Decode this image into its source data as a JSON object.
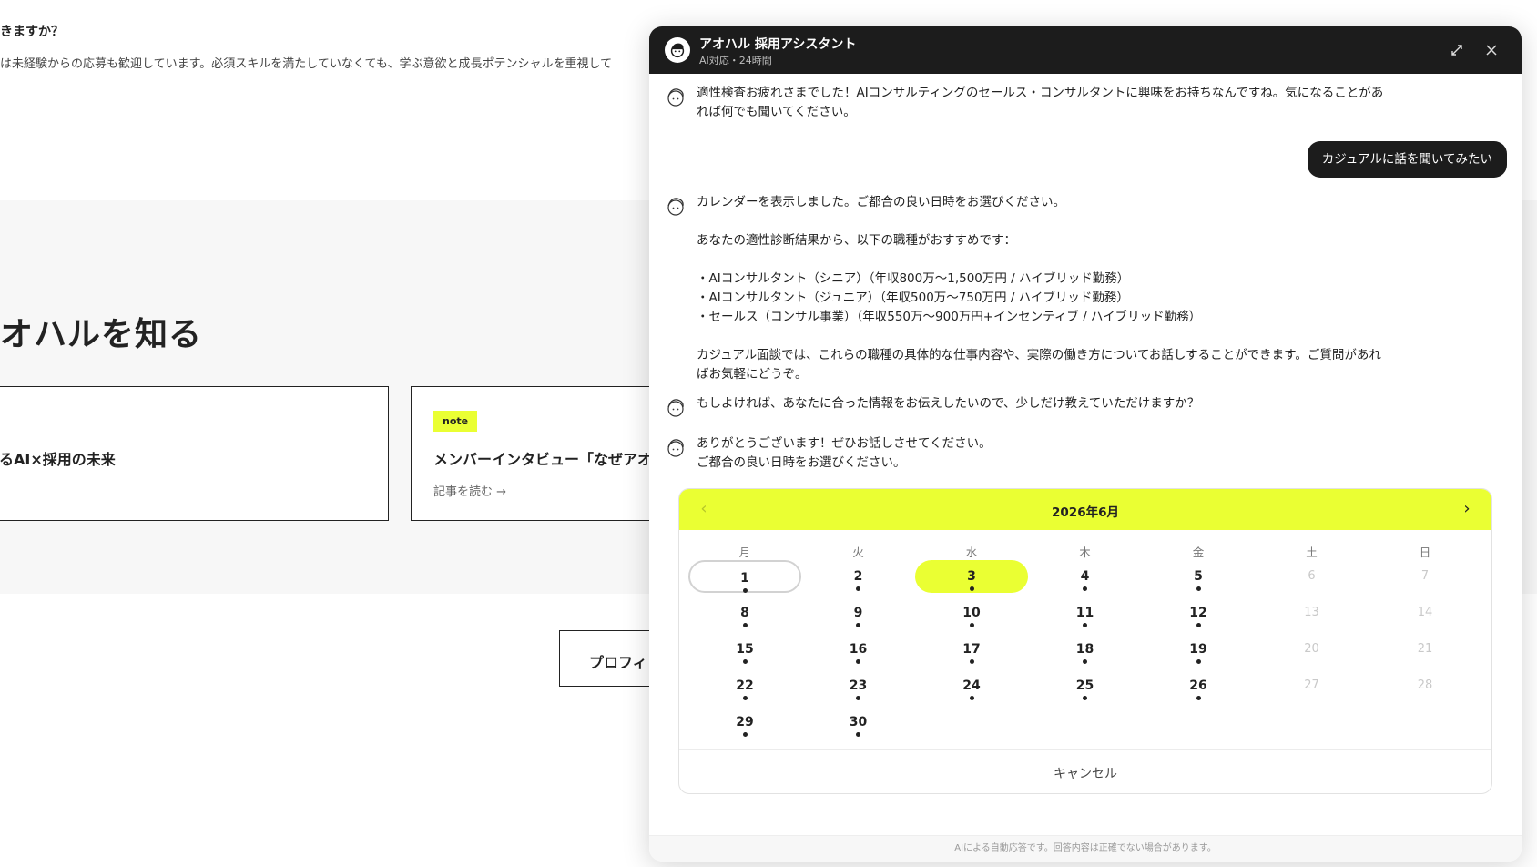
{
  "background": {
    "faq_question": "きますか？",
    "faq_answer": "は未経験からの応募も歓迎しています。必須スキルを満たしていなくても、学ぶ意欲と成長ポテンシャルを重視して",
    "section_heading": "オハルを知る",
    "cards": [
      {
        "tag": "",
        "title": "るAI×採用の未来",
        "link": ""
      },
      {
        "tag": "note",
        "title": "メンバーインタビュー「なぜアオ",
        "link": "記事を読む →"
      }
    ],
    "profile_button": "プロフィ"
  },
  "chat": {
    "title": "アオハル 採用アシスタント",
    "subtitle": "AI対応・24時間",
    "messages": {
      "m1": "適性検査お疲れさまでした！AIコンサルティングのセールス・コンサルタントに興味をお持ちなんですね。気になることがあ\nれば何でも聞いてください。",
      "user1": "カジュアルに話を聞いてみたい",
      "m2": "カレンダーを表示しました。ご都合の良い日時をお選びください。\n\nあなたの適性診断結果から、以下の職種がおすすめです：\n\n・AIコンサルタント（シニア）（年収800万〜1,500万円 / ハイブリッド勤務）\n・AIコンサルタント（ジュニア）（年収500万〜750万円 / ハイブリッド勤務）\n・セールス（コンサル事業）（年収550万〜900万円+インセンティブ / ハイブリッド勤務）\n\nカジュアル面談では、これらの職種の具体的な仕事内容や、実際の働き方についてお話しすることができます。ご質問があれ\nばお気軽にどうぞ。",
      "m3": "もしよければ、あなたに合った情報をお伝えしたいので、少しだけ教えていただけますか？",
      "m4": "ありがとうございます！ぜひお話しさせてください。\nご都合の良い日時をお選びください。"
    },
    "calendar": {
      "month_label": "2026年6月",
      "weekdays": [
        "月",
        "火",
        "水",
        "木",
        "金",
        "土",
        "日"
      ],
      "weeks": [
        [
          1,
          2,
          3,
          4,
          5,
          6,
          7
        ],
        [
          8,
          9,
          10,
          11,
          12,
          13,
          14
        ],
        [
          15,
          16,
          17,
          18,
          19,
          20,
          21
        ],
        [
          22,
          23,
          24,
          25,
          26,
          27,
          28
        ],
        [
          29,
          30
        ]
      ],
      "today": 1,
      "selected": 3,
      "unavailable": [
        6,
        7,
        13,
        14,
        20,
        21,
        27,
        28
      ],
      "cancel_label": "キャンセル"
    },
    "footer": "AIによる自動応答です。回答内容は正確でない場合があります。"
  },
  "colors": {
    "accent": "#eaff33",
    "dark": "#1c1c1c"
  }
}
